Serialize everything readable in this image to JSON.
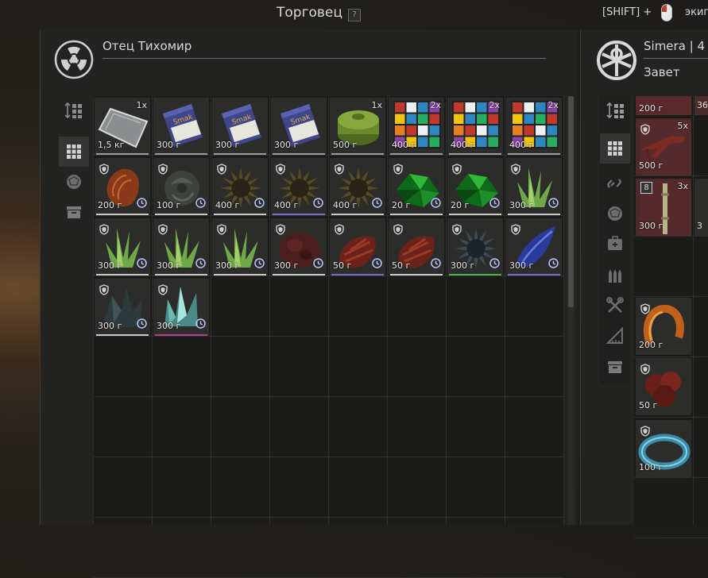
{
  "window": {
    "title": "Торговец",
    "help_label": "?",
    "hint_prefix": "[SHIFT] +",
    "hint_action": "экип"
  },
  "trader": {
    "name": "Отец Тихомир",
    "logo_icon": "radiation-trefoil-icon"
  },
  "player": {
    "name": "Simera | 4",
    "faction": "Завет",
    "logo_icon": "faction-emblem-icon"
  },
  "trader_sidebar": [
    {
      "name": "sort-icon",
      "active": false
    },
    {
      "name": "grid-view-icon",
      "active": true
    },
    {
      "name": "artifact-category-icon",
      "active": false
    },
    {
      "name": "container-category-icon",
      "active": false
    }
  ],
  "player_sidebar": [
    {
      "name": "sort-icon"
    },
    {
      "name": "grid-view-icon"
    },
    {
      "name": "link-icon"
    },
    {
      "name": "artifact-category-icon"
    },
    {
      "name": "medkit-icon"
    },
    {
      "name": "ammo-icon"
    },
    {
      "name": "tools-icon"
    },
    {
      "name": "ruler-icon"
    },
    {
      "name": "container-category-icon"
    }
  ],
  "trader_items": [
    {
      "icon": "glass-plate-icon",
      "price": "1,5 кг",
      "qty": "1x",
      "shield": false,
      "timer": false,
      "accent": "#9a9a9a"
    },
    {
      "icon": "snack-box-icon",
      "price": "300 г",
      "qty": "",
      "shield": false,
      "timer": false,
      "accent": "#9a9a9a"
    },
    {
      "icon": "snack-box-icon",
      "price": "300 г",
      "qty": "",
      "shield": false,
      "timer": false,
      "accent": "#9a9a9a"
    },
    {
      "icon": "snack-box-icon",
      "price": "300 г",
      "qty": "",
      "shield": false,
      "timer": false,
      "accent": "#9a9a9a"
    },
    {
      "icon": "green-canister-icon",
      "price": "500 г",
      "qty": "1x",
      "shield": false,
      "timer": false,
      "accent": "#9a9a9a"
    },
    {
      "icon": "puzzle-cube-icon",
      "price": "400 г",
      "qty": "2x",
      "shield": false,
      "timer": false,
      "accent": "#9a9a9a"
    },
    {
      "icon": "puzzle-cube-icon",
      "price": "400 г",
      "qty": "2x",
      "shield": false,
      "timer": false,
      "accent": "#9a9a9a"
    },
    {
      "icon": "puzzle-cube-icon",
      "price": "400 г",
      "qty": "2x",
      "shield": false,
      "timer": false,
      "accent": "#9a9a9a"
    },
    {
      "icon": "seed-artifact-icon",
      "price": "200 г",
      "qty": "",
      "shield": true,
      "timer": true,
      "accent": "#c8c8c8"
    },
    {
      "icon": "stone-rose-artifact-icon",
      "price": "100 г",
      "qty": "",
      "shield": true,
      "timer": true,
      "accent": "#c8c8c8"
    },
    {
      "icon": "spiky-artifact-icon",
      "price": "400 г",
      "qty": "",
      "shield": true,
      "timer": true,
      "accent": "#c8c8c8"
    },
    {
      "icon": "spiky-artifact-icon",
      "price": "400 г",
      "qty": "",
      "shield": true,
      "timer": true,
      "accent": "#7a6ad0"
    },
    {
      "icon": "spiky-artifact-icon",
      "price": "400 г",
      "qty": "",
      "shield": true,
      "timer": true,
      "accent": "#c8c8c8"
    },
    {
      "icon": "green-crystal-artifact-icon",
      "price": "20 г",
      "qty": "",
      "shield": true,
      "timer": true,
      "accent": "#c8c8c8"
    },
    {
      "icon": "green-crystal-artifact-icon",
      "price": "20 г",
      "qty": "",
      "shield": true,
      "timer": true,
      "accent": "#c8c8c8"
    },
    {
      "icon": "grass-artifact-icon",
      "price": "300 г",
      "qty": "",
      "shield": true,
      "timer": true,
      "accent": "#c8c8c8"
    },
    {
      "icon": "grass-artifact-icon",
      "price": "300 г",
      "qty": "",
      "shield": true,
      "timer": true,
      "accent": "#c8c8c8"
    },
    {
      "icon": "grass-artifact-icon",
      "price": "300 г",
      "qty": "",
      "shield": true,
      "timer": true,
      "accent": "#c8c8c8"
    },
    {
      "icon": "grass-artifact-icon",
      "price": "300 г",
      "qty": "",
      "shield": true,
      "timer": true,
      "accent": "#c8c8c8"
    },
    {
      "icon": "flesh-artifact-icon",
      "price": "300 г",
      "qty": "",
      "shield": true,
      "timer": true,
      "accent": "#c8c8c8"
    },
    {
      "icon": "red-cone-artifact-icon",
      "price": "50 г",
      "qty": "",
      "shield": true,
      "timer": true,
      "accent": "#7a6ad0"
    },
    {
      "icon": "red-cone-artifact-icon",
      "price": "50 г",
      "qty": "",
      "shield": true,
      "timer": true,
      "accent": "#c8c8c8"
    },
    {
      "icon": "dark-spiky-artifact-icon",
      "price": "300 г",
      "qty": "",
      "shield": true,
      "timer": true,
      "accent": "#4caf50"
    },
    {
      "icon": "blue-wing-artifact-icon",
      "price": "300 г",
      "qty": "",
      "shield": true,
      "timer": true,
      "accent": "#7a6ad0"
    },
    {
      "icon": "dark-crystal-artifact-icon",
      "price": "300 г",
      "qty": "",
      "shield": true,
      "timer": true,
      "accent": "#c8c8c8"
    },
    {
      "icon": "ice-crystal-artifact-icon",
      "price": "300 г",
      "qty": "",
      "shield": true,
      "timer": true,
      "accent": "#b0408a"
    }
  ],
  "player_items": [
    {
      "icon": "partial-item-icon",
      "price": "200 г",
      "qty": "",
      "shield": false,
      "accent": "#c8c8c8",
      "rows": 0.4
    },
    {
      "icon": "red-weapon-icon",
      "price": "500 г",
      "qty": "5x",
      "shield": true,
      "accent": "#c8c8c8",
      "rows": 1
    },
    {
      "icon": "bandage-roll-icon",
      "price": "300 г",
      "qty": "3x",
      "shield": false,
      "badge": "8",
      "accent": "#c8c8c8",
      "rows": 1
    },
    {
      "icon": "orange-coil-artifact-icon",
      "price": "200 г",
      "qty": "",
      "shield": true,
      "accent": "#7a6ad0",
      "rows": 1
    },
    {
      "icon": "red-cluster-artifact-icon",
      "price": "50 г",
      "qty": "",
      "shield": true,
      "accent": "#4caf50",
      "rows": 1
    },
    {
      "icon": "blue-ring-artifact-icon",
      "price": "100 г",
      "qty": "",
      "shield": true,
      "accent": "#7a6ad0",
      "rows": 1
    }
  ],
  "player_edge_labels": {
    "top": "36",
    "mid": "3"
  },
  "scroll": {
    "position": 0.0
  }
}
